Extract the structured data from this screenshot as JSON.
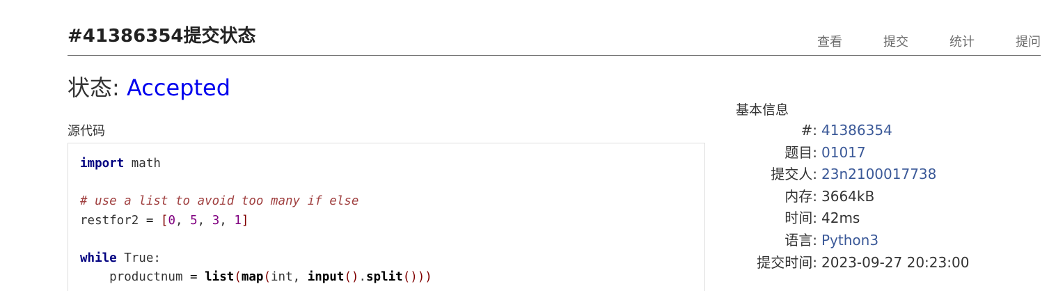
{
  "header": {
    "title": "#41386354提交状态",
    "nav": [
      "查看",
      "提交",
      "统计",
      "提问"
    ]
  },
  "status": {
    "label": "状态: ",
    "value": "Accepted"
  },
  "source": {
    "label": "源代码",
    "lines": [
      "import math",
      "",
      "# use a list to avoid too many if else",
      "restfor2 = [0, 5, 3, 1]",
      "",
      "while True:",
      "    productnum = list(map(int, input().split()))"
    ]
  },
  "info": {
    "title": "基本信息",
    "rows": [
      {
        "key": "#:",
        "value": "41386354",
        "link": true
      },
      {
        "key": "题目:",
        "value": "01017",
        "link": true
      },
      {
        "key": "提交人:",
        "value": "23n2100017738",
        "link": true
      },
      {
        "key": "内存:",
        "value": "3664kB",
        "link": false
      },
      {
        "key": "时间:",
        "value": "42ms",
        "link": false
      },
      {
        "key": "语言:",
        "value": "Python3",
        "link": true
      },
      {
        "key": "提交时间:",
        "value": "2023-09-27 20:23:00",
        "link": false
      }
    ]
  }
}
